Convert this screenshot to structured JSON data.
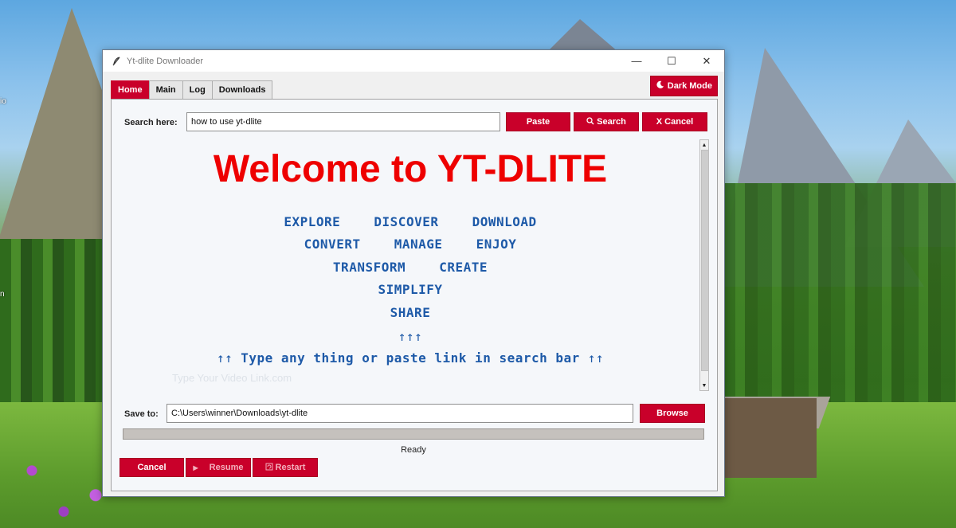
{
  "window": {
    "title": "Yt-dlite Downloader",
    "minimize_glyph": "—",
    "maximize_glyph": "☐",
    "close_glyph": "✕"
  },
  "desktop": {
    "edge_labels": [
      "io",
      "n"
    ]
  },
  "tabs": [
    {
      "label": "Home",
      "active": true
    },
    {
      "label": "Main",
      "active": false
    },
    {
      "label": "Log",
      "active": false
    },
    {
      "label": "Downloads",
      "active": false
    }
  ],
  "dark_mode": {
    "label": "Dark Mode",
    "icon": "moon-icon"
  },
  "search": {
    "label": "Search here:",
    "value": "how to use yt-dlite",
    "paste_label": "Paste",
    "search_label": "Search",
    "search_icon": "magnifier-icon",
    "cancel_label": "X Cancel"
  },
  "welcome": {
    "headline": "Welcome to YT-DLITE",
    "row1": [
      "EXPLORE",
      "DISCOVER",
      "DOWNLOAD"
    ],
    "row2": [
      "CONVERT",
      "MANAGE",
      "ENJOY"
    ],
    "row3": [
      "TRANSFORM",
      "CREATE"
    ],
    "row4": "SIMPLIFY",
    "row5": "SHARE",
    "arrows_up": "↑↑↑",
    "hint_left_arrows": "↑↑",
    "hint": "Type any thing or paste link in search bar",
    "hint_right_arrows": "↑↑",
    "placeholder_faint": "Type Your Video Link.com"
  },
  "save": {
    "label": "Save to:",
    "path": "C:\\Users\\winner\\Downloads\\yt-dlite",
    "browse_label": "Browse"
  },
  "progress": {
    "fraction": 0.0
  },
  "status": "Ready",
  "controls": {
    "cancel_label": "Cancel",
    "resume_label": "Resume",
    "resume_icon": "play-icon",
    "restart_label": "Restart",
    "restart_icon": "restart-icon"
  },
  "colors": {
    "accent": "#c9002a",
    "headline": "#ee0000",
    "keyword_blue": "#1e5aa8"
  }
}
